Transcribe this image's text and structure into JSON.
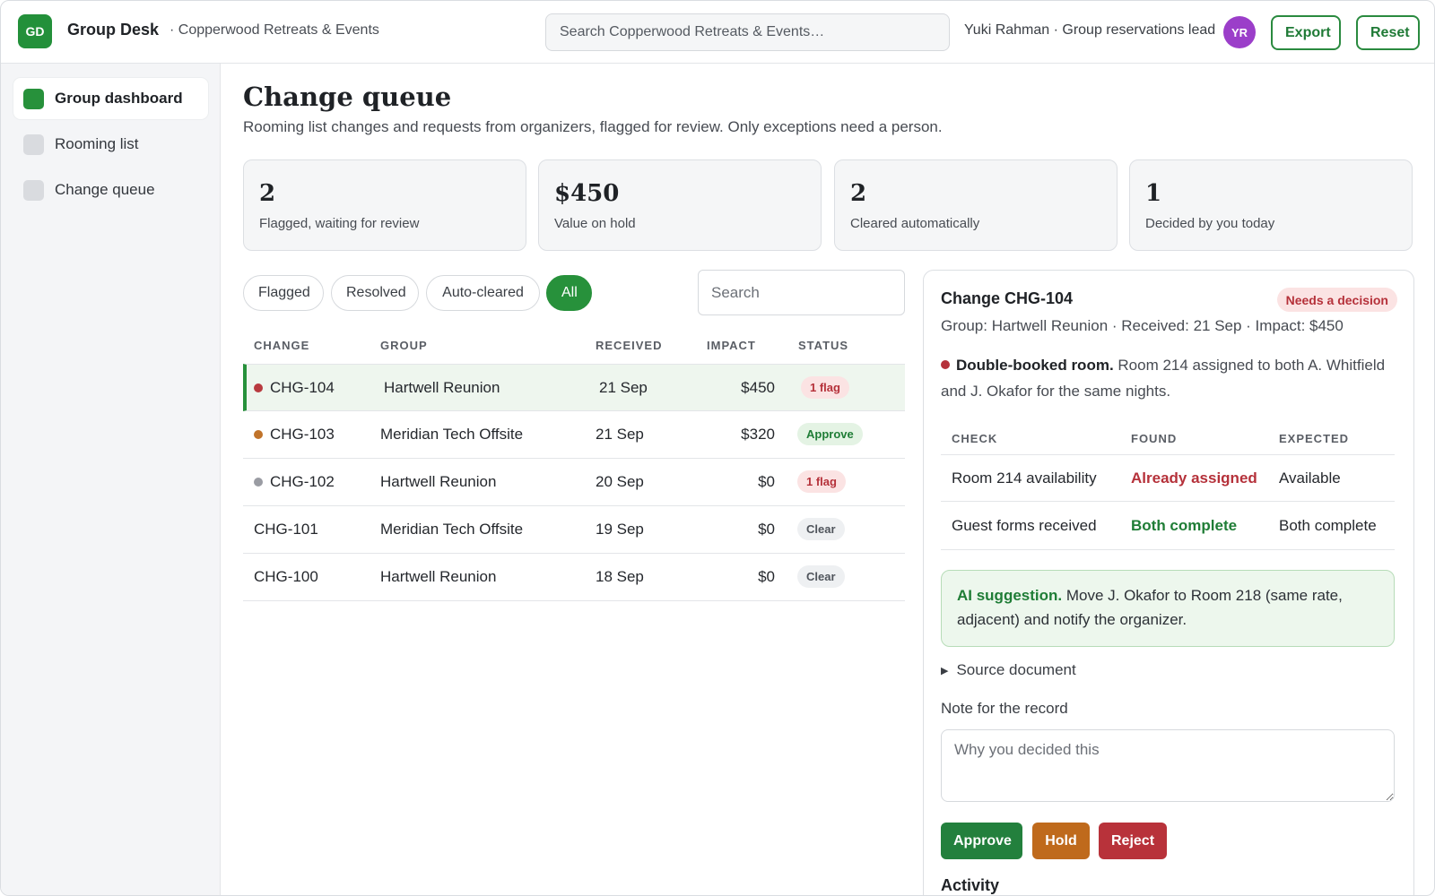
{
  "header": {
    "logo": "GD",
    "brand": "Group Desk",
    "org": "· Copperwood Retreats & Events",
    "search_placeholder": "Search Copperwood Retreats & Events…",
    "user": "Yuki Rahman · Group reservations lead",
    "avatar": "YR",
    "export_label": "Export",
    "reset_label": "Reset"
  },
  "sidebar": {
    "items": [
      {
        "label": "Group dashboard",
        "active": true
      },
      {
        "label": "Rooming list",
        "active": false
      },
      {
        "label": "Change queue",
        "active": false
      }
    ]
  },
  "main": {
    "title": "Change queue",
    "subtitle": "Rooming list changes and requests from organizers, flagged for review. Only exceptions need a person.",
    "stats": [
      {
        "value": "2",
        "label": "Flagged, waiting for review"
      },
      {
        "value": "$450",
        "label": "Value on hold"
      },
      {
        "value": "2",
        "label": "Cleared automatically"
      },
      {
        "value": "1",
        "label": "Decided by you today"
      }
    ],
    "filters": [
      "Flagged",
      "Resolved",
      "Auto-cleared",
      "All"
    ],
    "active_filter": "All",
    "search_placeholder": "Search",
    "columns": [
      "CHANGE",
      "GROUP",
      "RECEIVED",
      "IMPACT",
      "STATUS"
    ],
    "rows": [
      {
        "id": "CHG-104",
        "group": "Hartwell Reunion",
        "received": "21 Sep",
        "impact": "$450",
        "status": "1 flag",
        "status_type": "flag",
        "dot": "#b83a3f",
        "selected": true
      },
      {
        "id": "CHG-103",
        "group": "Meridian Tech Offsite",
        "received": "21 Sep",
        "impact": "$320",
        "status": "Approve",
        "status_type": "approve",
        "dot": "#c0732a",
        "selected": false
      },
      {
        "id": "CHG-102",
        "group": "Hartwell Reunion",
        "received": "20 Sep",
        "impact": "$0",
        "status": "1 flag",
        "status_type": "flag",
        "dot": "#9a9ca3",
        "selected": false
      },
      {
        "id": "CHG-101",
        "group": "Meridian Tech Offsite",
        "received": "19 Sep",
        "impact": "$0",
        "status": "Clear",
        "status_type": "clear",
        "dot": "",
        "selected": false
      },
      {
        "id": "CHG-100",
        "group": "Hartwell Reunion",
        "received": "18 Sep",
        "impact": "$0",
        "status": "Clear",
        "status_type": "clear",
        "dot": "",
        "selected": false
      }
    ]
  },
  "detail": {
    "title": "Change CHG-104",
    "pill": "Needs a decision",
    "meta": "Group: Hartwell Reunion · Received: 21 Sep · Impact: $450",
    "issue_title": "Double-booked room.",
    "issue_text": " Room 214 assigned to both A. Whitfield and J. Okafor for the same nights.",
    "check_columns": [
      "CHECK",
      "FOUND",
      "EXPECTED"
    ],
    "checks": [
      {
        "check": "Room 214 availability",
        "found": "Already assigned",
        "expected": "Available",
        "ok": false
      },
      {
        "check": "Guest forms received",
        "found": "Both complete",
        "expected": "Both complete",
        "ok": true
      }
    ],
    "ai_label": "AI suggestion.",
    "ai_text": " Move J. Okafor to Room 218 (same rate, adjacent) and notify the organizer.",
    "source_label": "Source document",
    "note_label": "Note for the record",
    "note_placeholder": "Why you decided this",
    "approve_label": "Approve",
    "hold_label": "Hold",
    "reject_label": "Reject",
    "activity_label": "Activity"
  }
}
